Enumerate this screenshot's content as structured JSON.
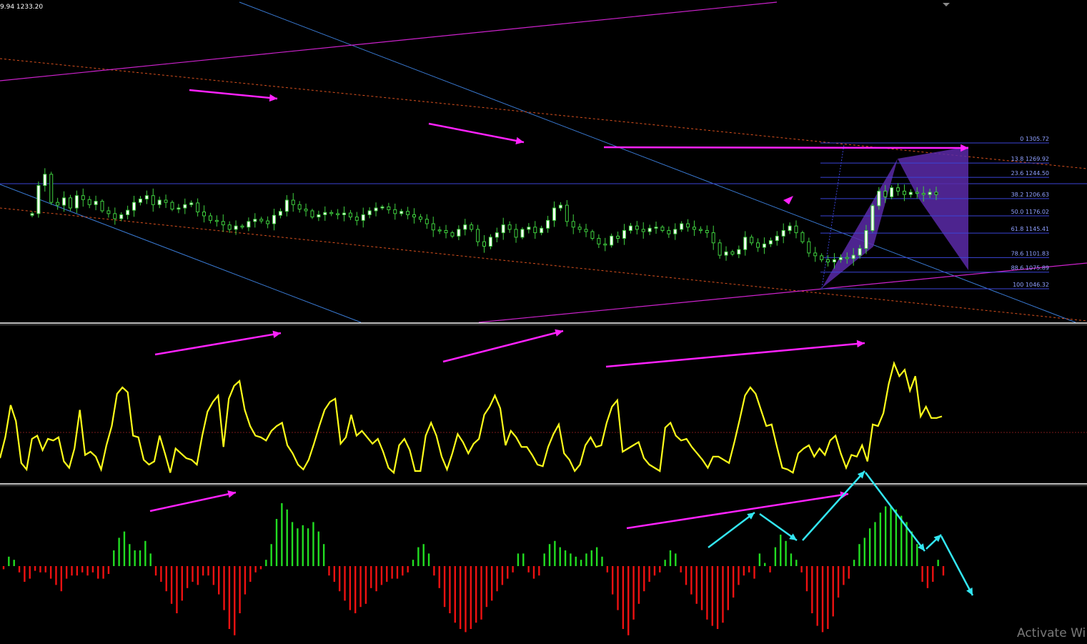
{
  "header": {
    "ohlc_text": "9.94 1233.20"
  },
  "watermark": {
    "text": "Activate Wi"
  },
  "colors": {
    "background": "#000000",
    "candle_up_body": "#ffffff",
    "candle_down_body": "#000000",
    "candle_wick": "#3fcf3f",
    "channel_blue": "#3a7bd5",
    "channel_orange": "#d8501e",
    "magenta": "#ff22ff",
    "harmonic_fill": "#5a2aa8",
    "fib_line": "#3b44d6",
    "fib_text": "#8fa0ff",
    "oscillator_line": "#ffff1a",
    "zero_dotted": "#7a1a1a",
    "hist_positive": "#22dd22",
    "hist_negative": "#ee1111",
    "cyan_arrow": "#33e6f2",
    "separator": "#ffffff"
  },
  "chart_data": [
    {
      "type": "candlestick",
      "panel": "price",
      "fibonacci_levels": [
        {
          "label": "0 1305.72",
          "ratio": 0.0,
          "price": 1305.72
        },
        {
          "label": "13.8 1269.92",
          "ratio": 13.8,
          "price": 1269.92
        },
        {
          "label": "23.6 1244.50",
          "ratio": 23.6,
          "price": 1244.5
        },
        {
          "label": "38.2 1206.63",
          "ratio": 38.2,
          "price": 1206.63
        },
        {
          "label": "50.0 1176.02",
          "ratio": 50.0,
          "price": 1176.02
        },
        {
          "label": "61.8 1145.41",
          "ratio": 61.8,
          "price": 1145.41
        },
        {
          "label": "78.6 1101.83",
          "ratio": 78.6,
          "price": 1101.83
        },
        {
          "label": "88.6 1075.89",
          "ratio": 88.6,
          "price": 1075.89
        },
        {
          "label": "100 1046.32",
          "ratio": 100.0,
          "price": 1046.32
        }
      ],
      "close": [
        1180,
        1230,
        1250,
        1200,
        1195,
        1208,
        1190,
        1212,
        1205,
        1196,
        1202,
        1185,
        1180,
        1171,
        1178,
        1186,
        1200,
        1206,
        1212,
        1196,
        1204,
        1200,
        1188,
        1190,
        1196,
        1199,
        1183,
        1176,
        1168,
        1166,
        1160,
        1152,
        1158,
        1156,
        1166,
        1170,
        1167,
        1162,
        1177,
        1184,
        1204,
        1196,
        1188,
        1185,
        1174,
        1178,
        1182,
        1180,
        1178,
        1181,
        1174,
        1168,
        1178,
        1185,
        1190,
        1192,
        1187,
        1180,
        1184,
        1178,
        1174,
        1170,
        1162,
        1151,
        1150,
        1146,
        1140,
        1152,
        1160,
        1152,
        1130,
        1122,
        1138,
        1146,
        1160,
        1152,
        1138,
        1152,
        1156,
        1146,
        1154,
        1168,
        1190,
        1195,
        1166,
        1156,
        1152,
        1148,
        1136,
        1126,
        1124,
        1140,
        1136,
        1150,
        1158,
        1152,
        1148,
        1154,
        1156,
        1150,
        1144,
        1152,
        1162,
        1156,
        1152,
        1150,
        1146,
        1128,
        1106,
        1112,
        1108,
        1116,
        1138,
        1128,
        1120,
        1126,
        1132,
        1140,
        1150,
        1158,
        1146,
        1130,
        1110,
        1105,
        1098,
        1094,
        1098,
        1102,
        1100,
        1106,
        1118,
        1150,
        1194,
        1220,
        1210,
        1226,
        1220,
        1214,
        1218,
        1216,
        1214,
        1218,
        1214
      ]
    },
    {
      "type": "line",
      "panel": "oscillator",
      "level_line": 0,
      "values": [
        -16,
        -3,
        17,
        7,
        -19,
        -23,
        -4,
        -2,
        -11,
        -4,
        -5,
        -3,
        -18,
        -22,
        -10,
        14,
        -14,
        -12,
        -15,
        -23,
        -8,
        4,
        24,
        28,
        25,
        -2,
        -3,
        -17,
        -20,
        -18,
        -2,
        -13,
        -25,
        -10,
        -13,
        -16,
        -17,
        -20,
        -2,
        13,
        19,
        23,
        -9,
        21,
        29,
        32,
        14,
        4,
        -2,
        -3,
        -5,
        1,
        4,
        6,
        -8,
        -13,
        -20,
        -23,
        -17,
        -7,
        4,
        14,
        19,
        21,
        -7,
        -3,
        11,
        -2,
        1,
        -3,
        -7,
        -4,
        -12,
        -22,
        -25,
        -8,
        -4,
        -11,
        -24,
        -24,
        -2,
        6,
        -2,
        -15,
        -23,
        -13,
        -1,
        -6,
        -13,
        -7,
        -4,
        11,
        16,
        23,
        15,
        -8,
        1,
        -3,
        -9,
        -9,
        -14,
        -20,
        -21,
        -9,
        -1,
        5,
        -13,
        -17,
        -24,
        -20,
        -8,
        -3,
        -9,
        -8,
        6,
        16,
        20,
        -12,
        -10,
        -8,
        -6,
        -16,
        -20,
        -22,
        -24,
        3,
        6,
        -2,
        -5,
        -4,
        -9,
        -13,
        -17,
        -22,
        -15,
        -15,
        -17,
        -19,
        -6,
        8,
        23,
        28,
        24,
        14,
        4,
        5,
        -9,
        -22,
        -23,
        -25,
        -13,
        -10,
        -8,
        -15,
        -10,
        -14,
        -5,
        -2,
        -13,
        -22,
        -14,
        -15,
        -8,
        -18,
        5,
        4,
        12,
        30,
        43,
        35,
        39,
        26,
        35,
        10,
        16,
        9,
        9,
        10
      ]
    },
    {
      "type": "bar",
      "panel": "histogram",
      "zero_line": 0,
      "values": [
        -2,
        6,
        4,
        -4,
        -10,
        -8,
        -3,
        -4,
        -4,
        -8,
        -12,
        -16,
        -8,
        -6,
        -6,
        -4,
        -6,
        -4,
        -8,
        -8,
        -5,
        10,
        18,
        22,
        14,
        10,
        10,
        16,
        8,
        -6,
        -10,
        -16,
        -24,
        -30,
        -22,
        -14,
        -10,
        -12,
        -6,
        -6,
        -12,
        -18,
        -28,
        -40,
        -44,
        -30,
        -18,
        -10,
        -4,
        -2,
        4,
        14,
        30,
        40,
        36,
        28,
        24,
        26,
        24,
        28,
        22,
        14,
        -6,
        -10,
        -16,
        -22,
        -28,
        -30,
        -26,
        -24,
        -14,
        -16,
        -12,
        -10,
        -8,
        -8,
        -6,
        -4,
        4,
        12,
        14,
        8,
        -6,
        -14,
        -26,
        -30,
        -36,
        -40,
        -42,
        -40,
        -36,
        -34,
        -26,
        -22,
        -16,
        -12,
        -8,
        -4,
        8,
        8,
        -4,
        -8,
        -6,
        8,
        14,
        16,
        12,
        10,
        8,
        6,
        4,
        8,
        10,
        12,
        6,
        -4,
        -18,
        -28,
        -40,
        -44,
        -34,
        -24,
        -16,
        -10,
        -6,
        -4,
        4,
        10,
        8,
        -4,
        -12,
        -18,
        -24,
        -28,
        -34,
        -38,
        -40,
        -36,
        -28,
        -20,
        -12,
        -6,
        -4,
        -8,
        8,
        2,
        -4,
        12,
        20,
        16,
        8,
        4,
        -4,
        -16,
        -30,
        -38,
        -42,
        -40,
        -32,
        -20,
        -12,
        -8,
        4,
        14,
        18,
        24,
        28,
        34,
        38,
        38,
        36,
        32,
        28,
        22,
        14,
        -10,
        -14,
        -10,
        4,
        -6
      ]
    }
  ]
}
